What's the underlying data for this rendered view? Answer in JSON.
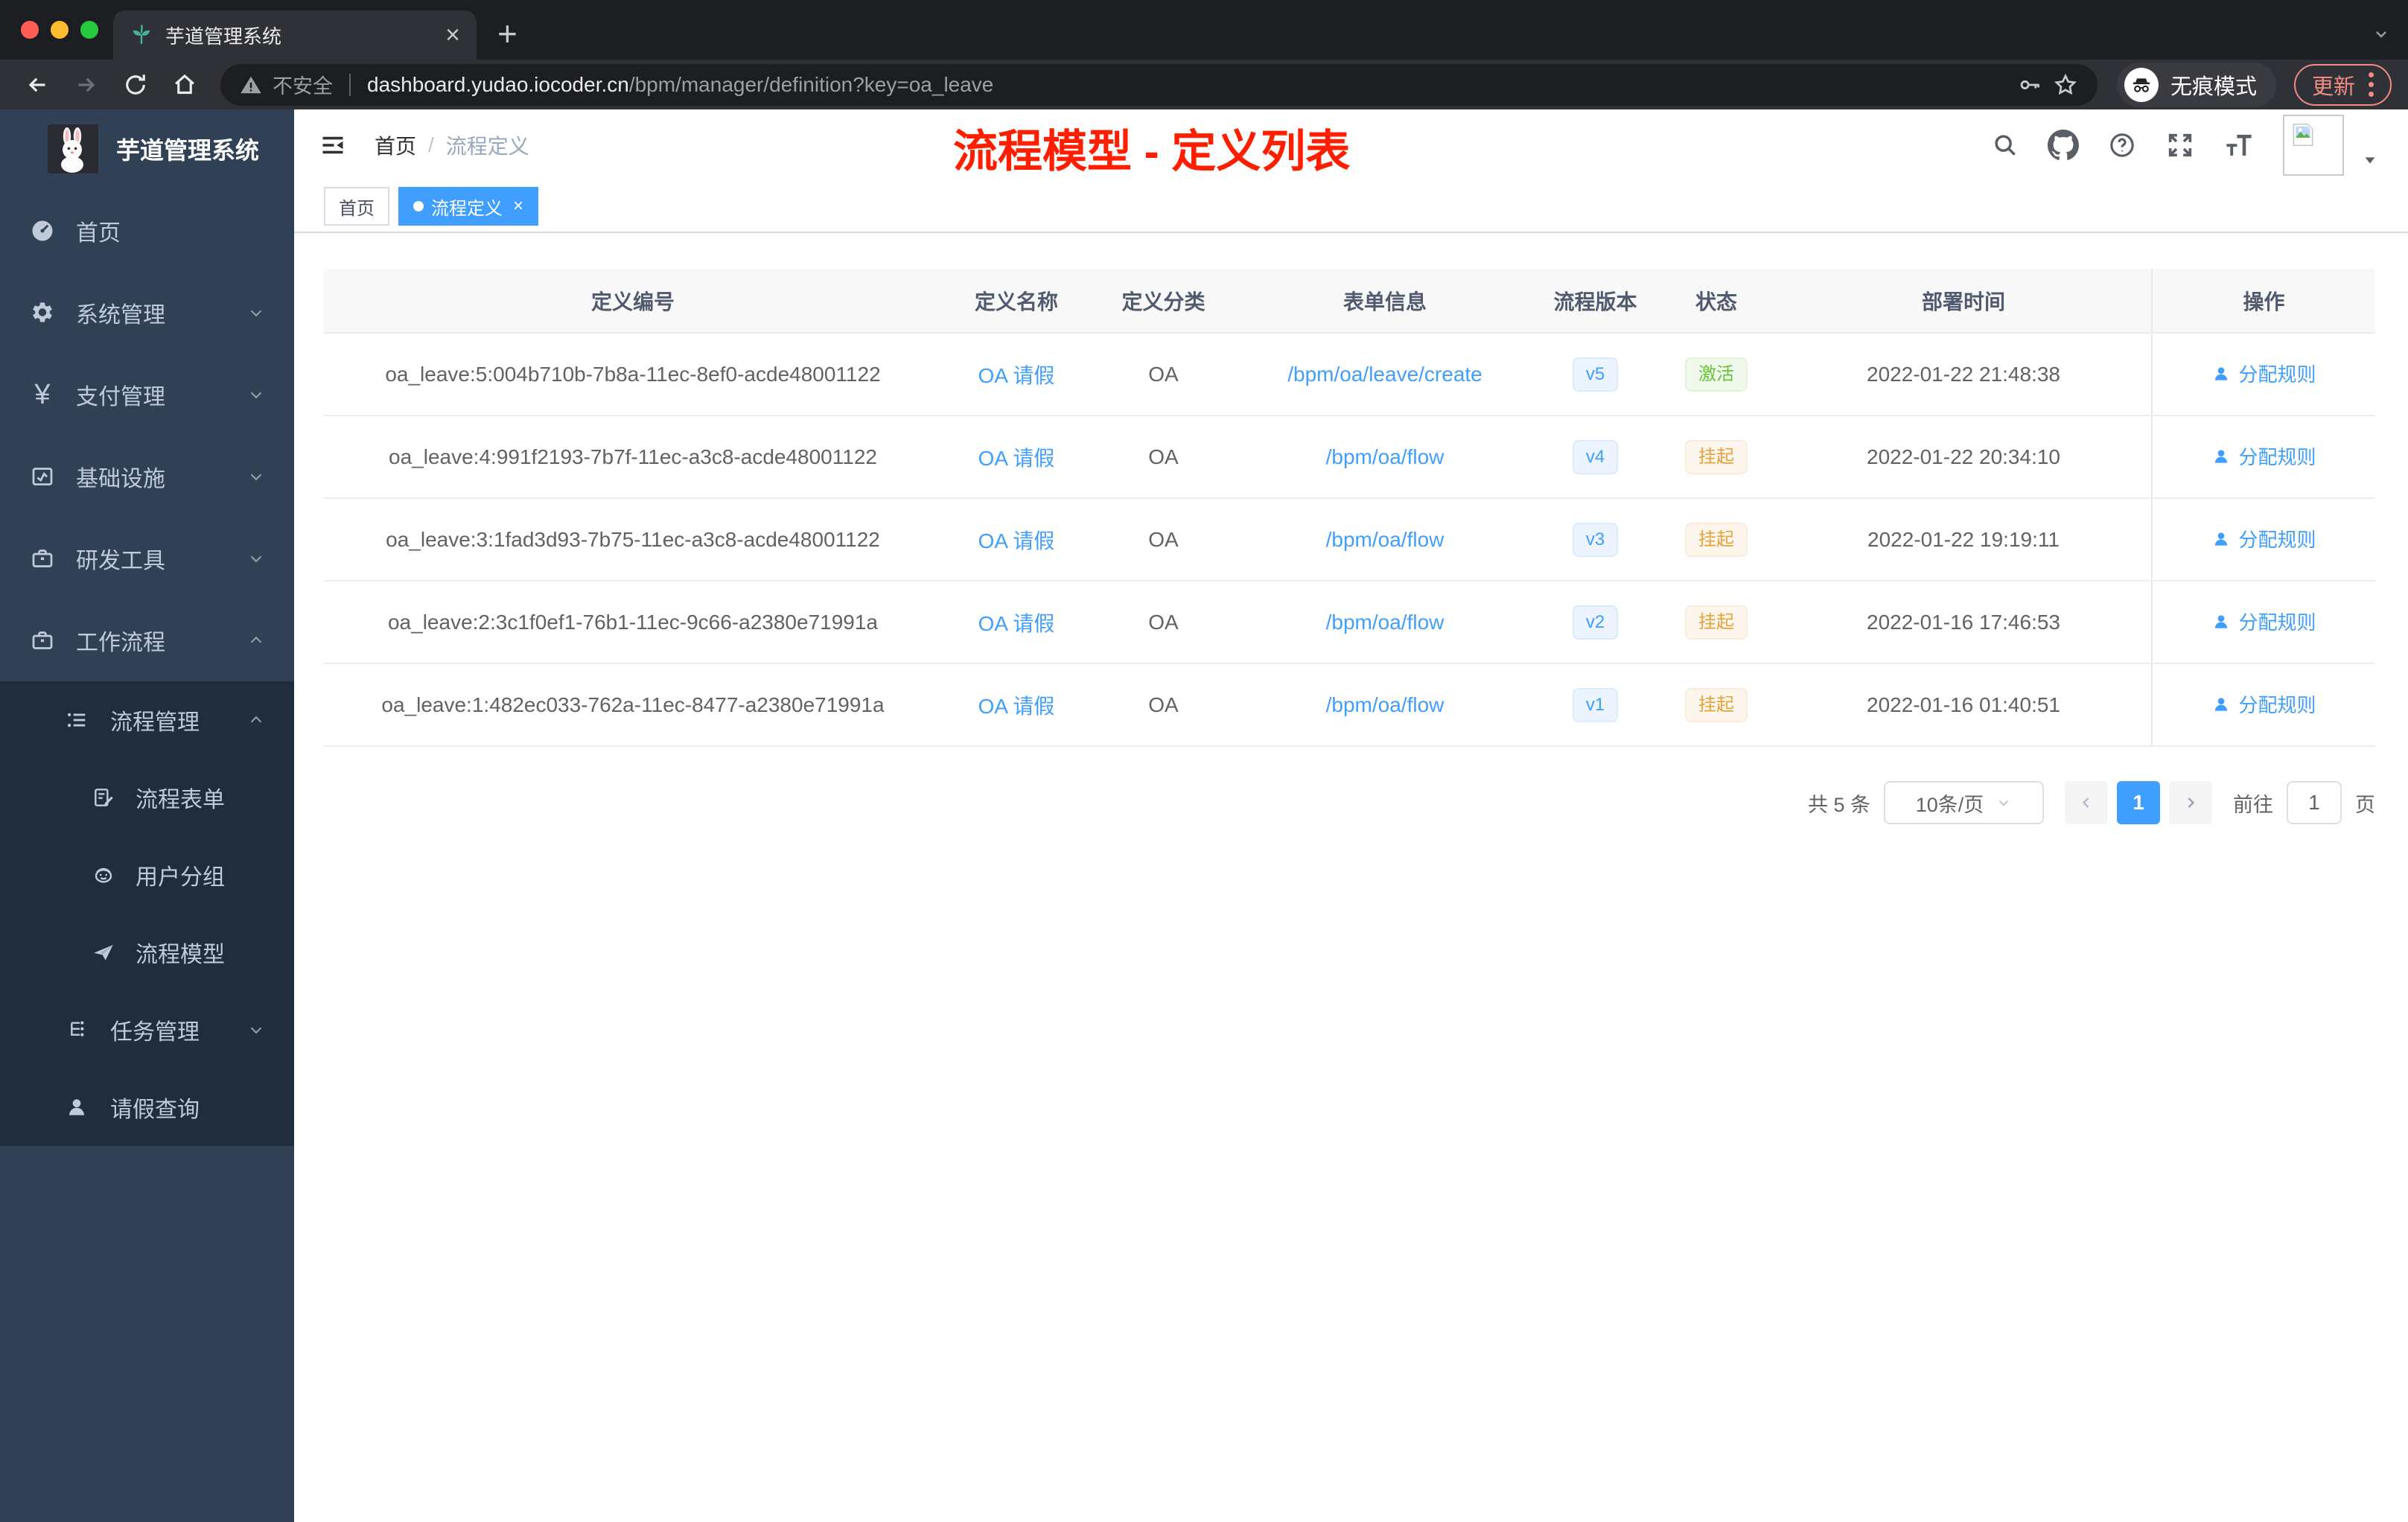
{
  "browser": {
    "tab_title": "芋道管理系统",
    "security_label": "不安全",
    "url_domain": "dashboard.yudao.iocoder.cn",
    "url_path": "/bpm/manager/definition?key=oa_leave",
    "incognito_label": "无痕模式",
    "update_label": "更新"
  },
  "sidebar": {
    "app_title": "芋道管理系统",
    "items": [
      {
        "label": "首页"
      },
      {
        "label": "系统管理"
      },
      {
        "label": "支付管理"
      },
      {
        "label": "基础设施"
      },
      {
        "label": "研发工具"
      },
      {
        "label": "工作流程"
      },
      {
        "label": "流程管理"
      },
      {
        "label": "流程表单"
      },
      {
        "label": "用户分组"
      },
      {
        "label": "流程模型"
      },
      {
        "label": "任务管理"
      },
      {
        "label": "请假查询"
      }
    ]
  },
  "header": {
    "breadcrumb_home": "首页",
    "breadcrumb_sep": "/",
    "breadcrumb_current": "流程定义",
    "annotation_title": "流程模型 - 定义列表",
    "annotation_color": "#ff1e00"
  },
  "tags": {
    "home": "首页",
    "active": "流程定义",
    "close": "×"
  },
  "table": {
    "columns": [
      "定义编号",
      "定义名称",
      "定义分类",
      "表单信息",
      "流程版本",
      "状态",
      "部署时间",
      "操作"
    ],
    "rows": [
      {
        "id": "oa_leave:5:004b710b-7b8a-11ec-8ef0-acde48001122",
        "name": "OA 请假",
        "category": "OA",
        "form": "/bpm/oa/leave/create",
        "version": "v5",
        "status": "激活",
        "time": "2022-01-22 21:48:38",
        "action": "分配规则"
      },
      {
        "id": "oa_leave:4:991f2193-7b7f-11ec-a3c8-acde48001122",
        "name": "OA 请假",
        "category": "OA",
        "form": "/bpm/oa/flow",
        "version": "v4",
        "status": "挂起",
        "time": "2022-01-22 20:34:10",
        "action": "分配规则"
      },
      {
        "id": "oa_leave:3:1fad3d93-7b75-11ec-a3c8-acde48001122",
        "name": "OA 请假",
        "category": "OA",
        "form": "/bpm/oa/flow",
        "version": "v3",
        "status": "挂起",
        "time": "2022-01-22 19:19:11",
        "action": "分配规则"
      },
      {
        "id": "oa_leave:2:3c1f0ef1-76b1-11ec-9c66-a2380e71991a",
        "name": "OA 请假",
        "category": "OA",
        "form": "/bpm/oa/flow",
        "version": "v2",
        "status": "挂起",
        "time": "2022-01-16 17:46:53",
        "action": "分配规则"
      },
      {
        "id": "oa_leave:1:482ec033-762a-11ec-8477-a2380e71991a",
        "name": "OA 请假",
        "category": "OA",
        "form": "/bpm/oa/flow",
        "version": "v1",
        "status": "挂起",
        "time": "2022-01-16 01:40:51",
        "action": "分配规则"
      }
    ]
  },
  "pagination": {
    "total": "共 5 条",
    "page_size": "10条/页",
    "current": "1",
    "goto_label": "前往",
    "goto_value": "1",
    "unit": "页"
  },
  "colors": {
    "accent": "#409eff",
    "success": "#67c23a",
    "warning": "#e6a23c"
  }
}
